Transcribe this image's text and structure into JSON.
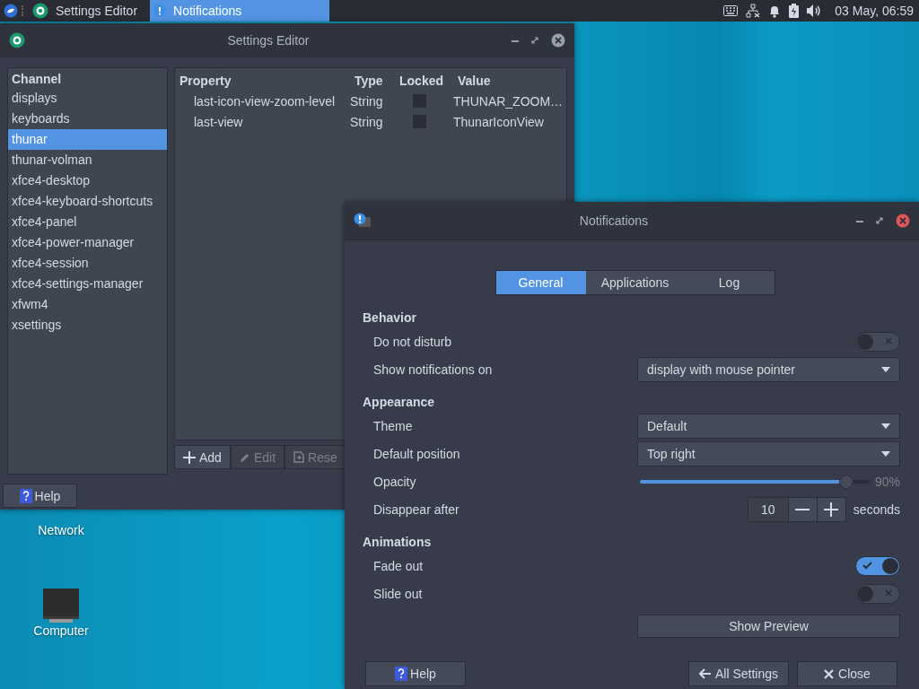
{
  "panel": {
    "tasks": [
      {
        "title": "Settings Editor",
        "selected": false
      },
      {
        "title": "Notifications",
        "selected": true
      }
    ],
    "clock": "03 May, 06:59"
  },
  "desktop_icons": [
    {
      "label": "Network",
      "kind": "hidden"
    },
    {
      "label": "Computer",
      "kind": "computer"
    }
  ],
  "settings_editor": {
    "title": "Settings Editor",
    "channel_header": "Channel",
    "channels": [
      {
        "name": "displays",
        "selected": false
      },
      {
        "name": "keyboards",
        "selected": false
      },
      {
        "name": "thunar",
        "selected": true
      },
      {
        "name": "thunar-volman",
        "selected": false
      },
      {
        "name": "xfce4-desktop",
        "selected": false
      },
      {
        "name": "xfce4-keyboard-shortcuts",
        "selected": false
      },
      {
        "name": "xfce4-panel",
        "selected": false
      },
      {
        "name": "xfce4-power-manager",
        "selected": false
      },
      {
        "name": "xfce4-session",
        "selected": false
      },
      {
        "name": "xfce4-settings-manager",
        "selected": false
      },
      {
        "name": "xfwm4",
        "selected": false
      },
      {
        "name": "xsettings",
        "selected": false
      }
    ],
    "columns": [
      "Property",
      "Type",
      "Locked",
      "Value"
    ],
    "rows": [
      {
        "property": "last-icon-view-zoom-level",
        "type": "String",
        "locked": false,
        "value": "THUNAR_ZOOM…"
      },
      {
        "property": "last-view",
        "type": "String",
        "locked": false,
        "value": "ThunarIconView"
      }
    ],
    "buttons": [
      {
        "label": "Add",
        "kind": "add",
        "disabled": false
      },
      {
        "label": "Edit",
        "kind": "edit",
        "disabled": true
      },
      {
        "label": "Rese",
        "kind": "reset",
        "disabled": true
      }
    ],
    "help": "Help"
  },
  "notifications": {
    "title": "Notifications",
    "tabs": [
      {
        "label": "General",
        "selected": true
      },
      {
        "label": "Applications",
        "selected": false
      },
      {
        "label": "Log",
        "selected": false
      }
    ],
    "sections": [
      {
        "title": "Behavior",
        "rows": [
          {
            "kind": "toggle",
            "label": "Do not disturb",
            "on": false
          },
          {
            "kind": "dropdown",
            "label": "Show notifications on",
            "value": "display with mouse pointer"
          }
        ]
      },
      {
        "title": "Appearance",
        "rows": [
          {
            "kind": "dropdown",
            "label": "Theme",
            "value": "Default"
          },
          {
            "kind": "dropdown",
            "label": "Default position",
            "value": "Top right"
          },
          {
            "kind": "slider",
            "label": "Opacity",
            "level": 0.9,
            "reading": "90%"
          },
          {
            "kind": "spin",
            "label": "Disappear after",
            "value": "10",
            "unit": "seconds"
          }
        ]
      },
      {
        "title": "Animations",
        "rows": [
          {
            "kind": "toggle",
            "label": "Fade out",
            "on": true
          },
          {
            "kind": "toggle",
            "label": "Slide out",
            "on": false
          }
        ]
      }
    ],
    "preview_button": "Show Preview",
    "help": "Help",
    "buttons": [
      {
        "label": "All Settings",
        "kind": "back"
      },
      {
        "label": "Close",
        "kind": "close"
      }
    ]
  }
}
